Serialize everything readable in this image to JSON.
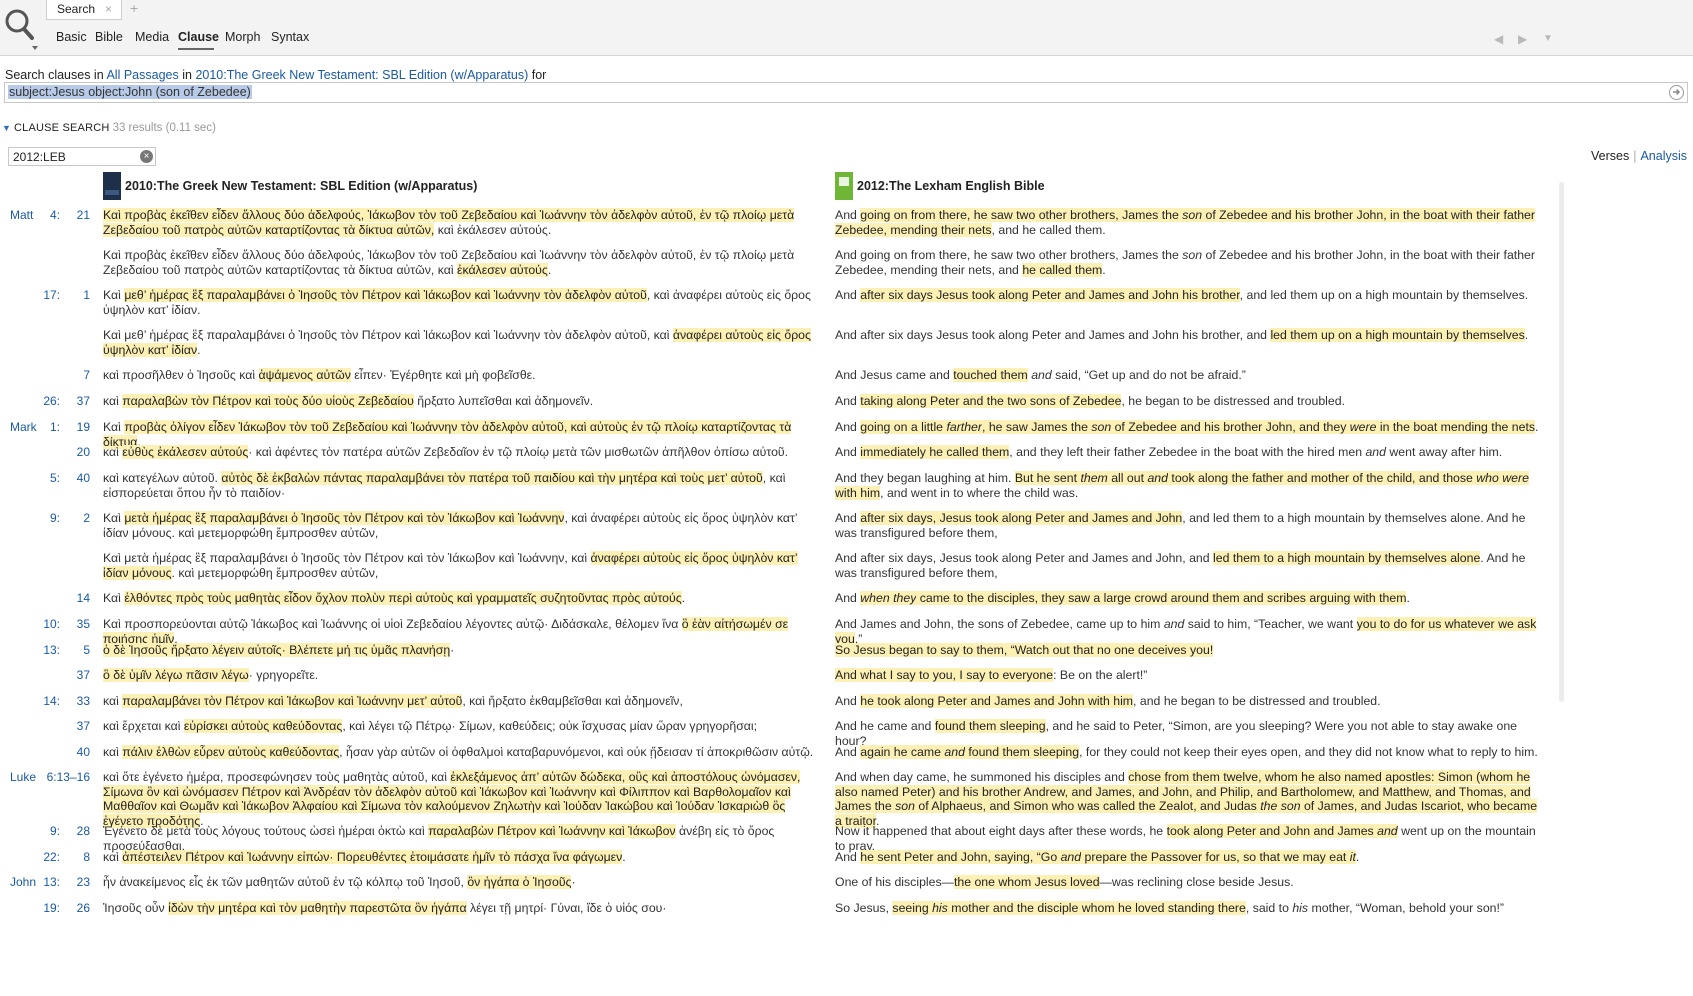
{
  "tabs": {
    "active": "Search",
    "close": "×",
    "add": "+"
  },
  "subnav": [
    "Basic",
    "Bible",
    "Media",
    "Clause",
    "Morph",
    "Syntax"
  ],
  "subnav_active": "Clause",
  "nav": {
    "back": "◀",
    "forward": "▶",
    "menu": "▼"
  },
  "searchline": {
    "prefix": "Search clauses in",
    "scope": "All Passages",
    "in": "in",
    "resource": "2010:The Greek New Testament: SBL Edition (w/Apparatus)",
    "for": "for"
  },
  "query": "subject:Jesus object:John (son of Zebedee)",
  "clause_search": {
    "title": "CLAUSE SEARCH",
    "count": "33 results (0.11 sec)"
  },
  "filter": {
    "value": "2012:LEB",
    "clear": "×"
  },
  "views": {
    "verses": "Verses",
    "sep": "|",
    "analysis": "Analysis"
  },
  "columns": {
    "greek": "2010:The Greek New Testament: SBL Edition (w/Apparatus)",
    "english": "2012:The Lexham English Bible",
    "greek_badge": "SBLGNT",
    "english_badge": "LEB"
  },
  "rows": [
    {
      "book": "Matt",
      "ch": "4:",
      "vs": "21",
      "greek": [
        [
          "h",
          "Καὶ προβὰς ἐκεῖθεν εἶδεν ἄλλους δύο ἀδελφούς, Ἰάκωβον τὸν τοῦ Ζεβεδαίου καὶ Ἰωάννην τὸν ἀδελφὸν αὐτοῦ, ἐν τῷ πλοίῳ μετὰ Ζεβεδαίου τοῦ πατρὸς αὐτῶν καταρτίζοντας τὰ δίκτυα αὐτῶν,"
        ],
        [
          "n",
          " καὶ ἐκάλεσεν αὐτούς."
        ]
      ],
      "eng": [
        [
          "n",
          "And "
        ],
        [
          "h",
          "going on from there, he saw two other brothers, James the "
        ],
        [
          "hi",
          "son"
        ],
        [
          "h",
          " of Zebedee and his brother John, in the boat with their father Zebedee, mending their nets"
        ],
        [
          "n",
          ", and he called them."
        ]
      ]
    },
    {
      "book": "",
      "ch": "",
      "vs": "",
      "greek": [
        [
          "n",
          "Καὶ προβὰς ἐκεῖθεν εἶδεν ἄλλους δύο ἀδελφούς, Ἰάκωβον τὸν τοῦ Ζεβεδαίου καὶ Ἰωάννην τὸν ἀδελφὸν αὐτοῦ, ἐν τῷ πλοίῳ μετὰ Ζεβεδαίου τοῦ πατρὸς αὐτῶν καταρτίζοντας τὰ δίκτυα αὐτῶν, καὶ "
        ],
        [
          "h",
          "ἐκάλεσεν αὐτούς"
        ],
        [
          "n",
          "."
        ]
      ],
      "eng": [
        [
          "n",
          "And going on from there, he saw two other brothers, James the "
        ],
        [
          "i",
          "son"
        ],
        [
          "n",
          " of Zebedee and his brother John, in the boat with their father Zebedee, mending their nets, and "
        ],
        [
          "h",
          "he called them"
        ],
        [
          "n",
          "."
        ]
      ]
    },
    {
      "book": "",
      "ch": "17:",
      "vs": "1",
      "greek": [
        [
          "n",
          "Καὶ "
        ],
        [
          "h",
          "μεθ’ ἡμέρας ἓξ παραλαμβάνει ὁ Ἰησοῦς τὸν Πέτρον καὶ Ἰάκωβον καὶ Ἰωάννην τὸν ἀδελφὸν αὐτοῦ"
        ],
        [
          "n",
          ", καὶ ἀναφέρει αὐτοὺς εἰς ὄρος ὑψηλὸν κατ’ ἰδίαν."
        ]
      ],
      "eng": [
        [
          "n",
          "And "
        ],
        [
          "h",
          "after six days Jesus took along Peter and James and John his brother"
        ],
        [
          "n",
          ", and led them up on a high mountain by themselves."
        ]
      ]
    },
    {
      "book": "",
      "ch": "",
      "vs": "",
      "greek": [
        [
          "n",
          "Καὶ μεθ’ ἡμέρας ἓξ παραλαμβάνει ὁ Ἰησοῦς τὸν Πέτρον καὶ Ἰάκωβον καὶ Ἰωάννην τὸν ἀδελφὸν αὐτοῦ, καὶ "
        ],
        [
          "h",
          "ἀναφέρει αὐτοὺς εἰς ὄρος ὑψηλὸν κατ’ ἰδίαν"
        ],
        [
          "n",
          "."
        ]
      ],
      "eng": [
        [
          "n",
          "And after six days Jesus took along Peter and James and John his brother, and "
        ],
        [
          "h",
          "led them up on a high mountain by themselves"
        ],
        [
          "n",
          "."
        ]
      ]
    },
    {
      "book": "",
      "ch": "",
      "vs": "7",
      "greek": [
        [
          "n",
          "καὶ προσῆλθεν ὁ Ἰησοῦς καὶ "
        ],
        [
          "h",
          "ἁψάμενος αὐτῶν"
        ],
        [
          "n",
          " εἶπεν· Ἐγέρθητε καὶ μὴ φοβεῖσθε."
        ]
      ],
      "eng": [
        [
          "n",
          "And Jesus came and "
        ],
        [
          "h",
          "touched them"
        ],
        [
          "n",
          " "
        ],
        [
          "i",
          "and"
        ],
        [
          "n",
          " said, “Get up and do not be afraid.”"
        ]
      ]
    },
    {
      "book": "",
      "ch": "26:",
      "vs": "37",
      "greek": [
        [
          "n",
          "καὶ "
        ],
        [
          "h",
          "παραλαβὼν τὸν Πέτρον καὶ τοὺς δύο υἱοὺς Ζεβεδαίου"
        ],
        [
          "n",
          " ἤρξατο λυπεῖσθαι καὶ ἀδημονεῖν."
        ]
      ],
      "eng": [
        [
          "n",
          "And "
        ],
        [
          "h",
          "taking along Peter and the two sons of Zebedee"
        ],
        [
          "n",
          ", he began to be distressed and troubled."
        ]
      ]
    },
    {
      "book": "Mark",
      "ch": "1:",
      "vs": "19",
      "greek": [
        [
          "n",
          "Καὶ "
        ],
        [
          "h",
          "προβὰς ὀλίγον εἶδεν Ἰάκωβον τὸν τοῦ Ζεβεδαίου καὶ Ἰωάννην τὸν ἀδελφὸν αὐτοῦ, καὶ αὐτοὺς ἐν τῷ πλοίῳ καταρτίζοντας τὰ δίκτυα"
        ],
        [
          "n",
          ","
        ]
      ],
      "eng": [
        [
          "n",
          "And "
        ],
        [
          "h",
          "going on a little "
        ],
        [
          "hi",
          "farther"
        ],
        [
          "h",
          ", he saw James the "
        ],
        [
          "hi",
          "son"
        ],
        [
          "h",
          " of Zebedee and his brother John, and they "
        ],
        [
          "hi",
          "were"
        ],
        [
          "h",
          " in the boat mending the nets"
        ],
        [
          "n",
          "."
        ]
      ]
    },
    {
      "book": "",
      "ch": "",
      "vs": "20",
      "greek": [
        [
          "n",
          "καὶ "
        ],
        [
          "h",
          "εὐθὺς ἐκάλεσεν αὐτούς"
        ],
        [
          "n",
          "· καὶ ἀφέντες τὸν πατέρα αὐτῶν Ζεβεδαῖον ἐν τῷ πλοίῳ μετὰ τῶν μισθωτῶν ἀπῆλθον ὀπίσω αὐτοῦ."
        ]
      ],
      "eng": [
        [
          "n",
          "And "
        ],
        [
          "h",
          "immediately he called them"
        ],
        [
          "n",
          ", and they left their father Zebedee in the boat with the hired men "
        ],
        [
          "i",
          "and"
        ],
        [
          "n",
          " went away after him."
        ]
      ]
    },
    {
      "book": "",
      "ch": "5:",
      "vs": "40",
      "greek": [
        [
          "n",
          "καὶ κατεγέλων αὐτοῦ. "
        ],
        [
          "h",
          "αὐτὸς δὲ ἐκβαλὼν πάντας παραλαμβάνει τὸν πατέρα τοῦ παιδίου καὶ τὴν μητέρα καὶ τοὺς μετ’ αὐτοῦ"
        ],
        [
          "n",
          ", καὶ εἰσπορεύεται ὅπου ἦν τὸ παιδίον·"
        ]
      ],
      "eng": [
        [
          "n",
          "And they began laughing at him. "
        ],
        [
          "h",
          "But he sent "
        ],
        [
          "hi",
          "them"
        ],
        [
          "h",
          " all out "
        ],
        [
          "hi",
          "and"
        ],
        [
          "h",
          " took along the father and mother of the child, and those "
        ],
        [
          "hi",
          "who were"
        ],
        [
          "h",
          " with him"
        ],
        [
          "n",
          ", and went in to where the child was."
        ]
      ]
    },
    {
      "book": "",
      "ch": "9:",
      "vs": "2",
      "greek": [
        [
          "n",
          "Καὶ "
        ],
        [
          "h",
          "μετὰ ἡμέρας ἓξ παραλαμβάνει ὁ Ἰησοῦς τὸν Πέτρον καὶ τὸν Ἰάκωβον καὶ Ἰωάννην"
        ],
        [
          "n",
          ", καὶ ἀναφέρει αὐτοὺς εἰς ὄρος ὑψηλὸν κατ’ ἰδίαν μόνους. καὶ μετεμορφώθη ἔμπροσθεν αὐτῶν,"
        ]
      ],
      "eng": [
        [
          "n",
          "And "
        ],
        [
          "h",
          "after six days, Jesus took along Peter and James and John"
        ],
        [
          "n",
          ", and led them to a high mountain by themselves alone. And he was transfigured before them,"
        ]
      ]
    },
    {
      "book": "",
      "ch": "",
      "vs": "",
      "greek": [
        [
          "n",
          "Καὶ μετὰ ἡμέρας ἓξ παραλαμβάνει ὁ Ἰησοῦς τὸν Πέτρον καὶ τὸν Ἰάκωβον καὶ Ἰωάννην, καὶ "
        ],
        [
          "h",
          "ἀναφέρει αὐτοὺς εἰς ὄρος ὑψηλὸν κατ’ ἰδίαν μόνους"
        ],
        [
          "n",
          ". καὶ μετεμορφώθη ἔμπροσθεν αὐτῶν,"
        ]
      ],
      "eng": [
        [
          "n",
          "And after six days, Jesus took along Peter and James and John, and "
        ],
        [
          "h",
          "led them to a high mountain by themselves alone"
        ],
        [
          "n",
          ". And he was transfigured before them,"
        ]
      ]
    },
    {
      "book": "",
      "ch": "",
      "vs": "14",
      "greek": [
        [
          "n",
          "Καὶ "
        ],
        [
          "h",
          "ἐλθόντες πρὸς τοὺς μαθητὰς εἶδον ὄχλον πολὺν περὶ αὐτοὺς καὶ γραμματεῖς συζητοῦντας πρὸς αὐτούς"
        ],
        [
          "n",
          "."
        ]
      ],
      "eng": [
        [
          "n",
          "And "
        ],
        [
          "hi",
          "when they"
        ],
        [
          "h",
          " came to the disciples, they saw a large crowd around them and scribes arguing with them"
        ],
        [
          "n",
          "."
        ]
      ]
    },
    {
      "book": "",
      "ch": "10:",
      "vs": "35",
      "greek": [
        [
          "n",
          "Καὶ προσπορεύονται αὐτῷ Ἰάκωβος καὶ Ἰωάννης οἱ υἱοὶ Ζεβεδαίου λέγοντες αὐτῷ· Διδάσκαλε, θέλομεν ἵνα "
        ],
        [
          "h",
          "ὃ ἐὰν αἰτήσωμέν σε ποιήσῃς ἡμῖν"
        ],
        [
          "n",
          "."
        ]
      ],
      "eng": [
        [
          "n",
          "And James and John, the sons of Zebedee, came up to him "
        ],
        [
          "i",
          "and"
        ],
        [
          "n",
          " said to him, “Teacher, we want "
        ],
        [
          "h",
          "you to do for us whatever we ask you"
        ],
        [
          "n",
          ".”"
        ]
      ]
    },
    {
      "book": "",
      "ch": "13:",
      "vs": "5",
      "greek": [
        [
          "h",
          "ὁ δὲ Ἰησοῦς ἤρξατο λέγειν αὐτοῖς· Βλέπετε μή τις ὑμᾶς πλανήσῃ"
        ],
        [
          "n",
          "·"
        ]
      ],
      "eng": [
        [
          "h",
          "So Jesus began to say to them, “Watch out that no one deceives you!"
        ]
      ]
    },
    {
      "book": "",
      "ch": "",
      "vs": "37",
      "greek": [
        [
          "h",
          "ὃ δὲ ὑμῖν λέγω πᾶσιν λέγω"
        ],
        [
          "n",
          "· γρηγορεῖτε."
        ]
      ],
      "eng": [
        [
          "h",
          "And what I say to you, I say to everyone"
        ],
        [
          "n",
          ": Be on the alert!”"
        ]
      ]
    },
    {
      "book": "",
      "ch": "14:",
      "vs": "33",
      "greek": [
        [
          "n",
          "καὶ "
        ],
        [
          "h",
          "παραλαμβάνει τὸν Πέτρον καὶ Ἰάκωβον καὶ Ἰωάννην μετ’ αὐτοῦ"
        ],
        [
          "n",
          ", καὶ ἤρξατο ἐκθαμβεῖσθαι καὶ ἀδημονεῖν,"
        ]
      ],
      "eng": [
        [
          "n",
          "And "
        ],
        [
          "h",
          "he took along Peter and James and John with him"
        ],
        [
          "n",
          ", and he began to be distressed and troubled."
        ]
      ]
    },
    {
      "book": "",
      "ch": "",
      "vs": "37",
      "greek": [
        [
          "n",
          "καὶ ἔρχεται καὶ "
        ],
        [
          "h",
          "εὑρίσκει αὐτοὺς καθεύδοντας"
        ],
        [
          "n",
          ", καὶ λέγει τῷ Πέτρῳ· Σίμων, καθεύδεις; οὐκ ἴσχυσας μίαν ὥραν γρηγορῆσαι;"
        ]
      ],
      "eng": [
        [
          "n",
          "And he came and "
        ],
        [
          "h",
          "found them sleeping"
        ],
        [
          "n",
          ", and he said to Peter, “Simon, are you sleeping? Were you not able to stay awake one hour?"
        ]
      ]
    },
    {
      "book": "",
      "ch": "",
      "vs": "40",
      "greek": [
        [
          "n",
          "καὶ "
        ],
        [
          "h",
          "πάλιν ἐλθὼν εὗρεν αὐτοὺς καθεύδοντας"
        ],
        [
          "n",
          ", ἦσαν γὰρ αὐτῶν οἱ ὀφθαλμοὶ καταβαρυνόμενοι, καὶ οὐκ ᾔδεισαν τί ἀποκριθῶσιν αὐτῷ."
        ]
      ],
      "eng": [
        [
          "n",
          "And "
        ],
        [
          "h",
          "again he came "
        ],
        [
          "hi",
          "and"
        ],
        [
          "h",
          " found them sleeping"
        ],
        [
          "n",
          ", for they could not keep their eyes open, and they did not know what to reply to him."
        ]
      ]
    },
    {
      "book": "Luke",
      "ch": "6:13–16",
      "vs": "",
      "greek": [
        [
          "n",
          "καὶ ὅτε ἐγένετο ἡμέρα, προσεφώνησεν τοὺς μαθητὰς αὐτοῦ, καὶ "
        ],
        [
          "h",
          "ἐκλεξάμενος ἀπ’ αὐτῶν δώδεκα, οὓς καὶ ἀποστόλους ὠνόμασεν, Σίμωνα ὃν καὶ ὠνόμασεν Πέτρον καὶ Ἀνδρέαν τὸν ἀδελφὸν αὐτοῦ καὶ Ἰάκωβον καὶ Ἰωάννην καὶ Φίλιππον καὶ Βαρθολομαῖον καὶ Μαθθαῖον καὶ Θωμᾶν καὶ Ἰάκωβον Ἁλφαίου καὶ Σίμωνα τὸν καλούμενον Ζηλωτὴν καὶ Ἰούδαν Ἰακώβου καὶ Ἰούδαν Ἰσκαριὼθ ὃς ἐγένετο προδότης"
        ],
        [
          "n",
          "."
        ]
      ],
      "eng": [
        [
          "n",
          "And when day came, he summoned his disciples and "
        ],
        [
          "h",
          "chose from them twelve, whom he also named apostles: Simon (whom he also named Peter) and his brother Andrew, and James, and John, and Philip, and Bartholomew, and Matthew, and Thomas, and James the "
        ],
        [
          "hi",
          "son"
        ],
        [
          "h",
          " of Alphaeus, and Simon who was called the Zealot, and Judas "
        ],
        [
          "hi",
          "the son"
        ],
        [
          "h",
          " of James, and Judas Iscariot, who became a traitor"
        ],
        [
          "n",
          "."
        ]
      ]
    },
    {
      "book": "",
      "ch": "9:",
      "vs": "28",
      "greek": [
        [
          "n",
          "Ἐγένετο δὲ μετὰ τοὺς λόγους τούτους ὡσεὶ ἡμέραι ὀκτὼ καὶ "
        ],
        [
          "h",
          "παραλαβὼν Πέτρον καὶ Ἰωάννην καὶ Ἰάκωβον"
        ],
        [
          "n",
          " ἀνέβη εἰς τὸ ὄρος προσεύξασθαι."
        ]
      ],
      "eng": [
        [
          "n",
          "Now it happened that about eight days after these words, he "
        ],
        [
          "h",
          "took along Peter and John and James "
        ],
        [
          "hi",
          "and"
        ],
        [
          "n",
          " went up on the mountain to pray."
        ]
      ]
    },
    {
      "book": "",
      "ch": "22:",
      "vs": "8",
      "greek": [
        [
          "n",
          "καὶ "
        ],
        [
          "h",
          "ἀπέστειλεν Πέτρον καὶ Ἰωάννην εἰπών· Πορευθέντες ἑτοιμάσατε ἡμῖν τὸ πάσχα ἵνα φάγωμεν"
        ],
        [
          "n",
          "."
        ]
      ],
      "eng": [
        [
          "n",
          "And "
        ],
        [
          "h",
          "he sent Peter and John, saying, “Go "
        ],
        [
          "hi",
          "and"
        ],
        [
          "h",
          " prepare the Passover for us, so that we may eat "
        ],
        [
          "hi",
          "it"
        ],
        [
          "n",
          "."
        ]
      ]
    },
    {
      "book": "John",
      "ch": "13:",
      "vs": "23",
      "greek": [
        [
          "n",
          "ἦν ἀνακείμενος εἷς ἐκ τῶν μαθητῶν αὐτοῦ ἐν τῷ κόλπῳ τοῦ Ἰησοῦ, "
        ],
        [
          "h",
          "ὃν ἠγάπα ὁ Ἰησοῦς"
        ],
        [
          "n",
          "·"
        ]
      ],
      "eng": [
        [
          "n",
          "One of his disciples—"
        ],
        [
          "h",
          "the one whom Jesus loved"
        ],
        [
          "n",
          "—was reclining close beside Jesus."
        ]
      ]
    },
    {
      "book": "",
      "ch": "19:",
      "vs": "26",
      "greek": [
        [
          "n",
          "Ἰησοῦς οὖν "
        ],
        [
          "h",
          "ἰδὼν τὴν μητέρα καὶ τὸν μαθητὴν παρεστῶτα ὃν ἠγάπα"
        ],
        [
          "n",
          " λέγει τῇ μητρί· Γύναι, ἴδε ὁ υἱός σου·"
        ]
      ],
      "eng": [
        [
          "n",
          "So Jesus, "
        ],
        [
          "h",
          "seeing "
        ],
        [
          "hi",
          "his"
        ],
        [
          "h",
          " mother and the disciple whom he loved standing there"
        ],
        [
          "n",
          ", said to "
        ],
        [
          "i",
          "his"
        ],
        [
          "n",
          " mother, “Woman, behold your son!”"
        ]
      ]
    }
  ],
  "colors": {
    "highlight": "#fcf0b4",
    "link": "#1a5aa5",
    "query_selection": "#b7cbe8"
  }
}
